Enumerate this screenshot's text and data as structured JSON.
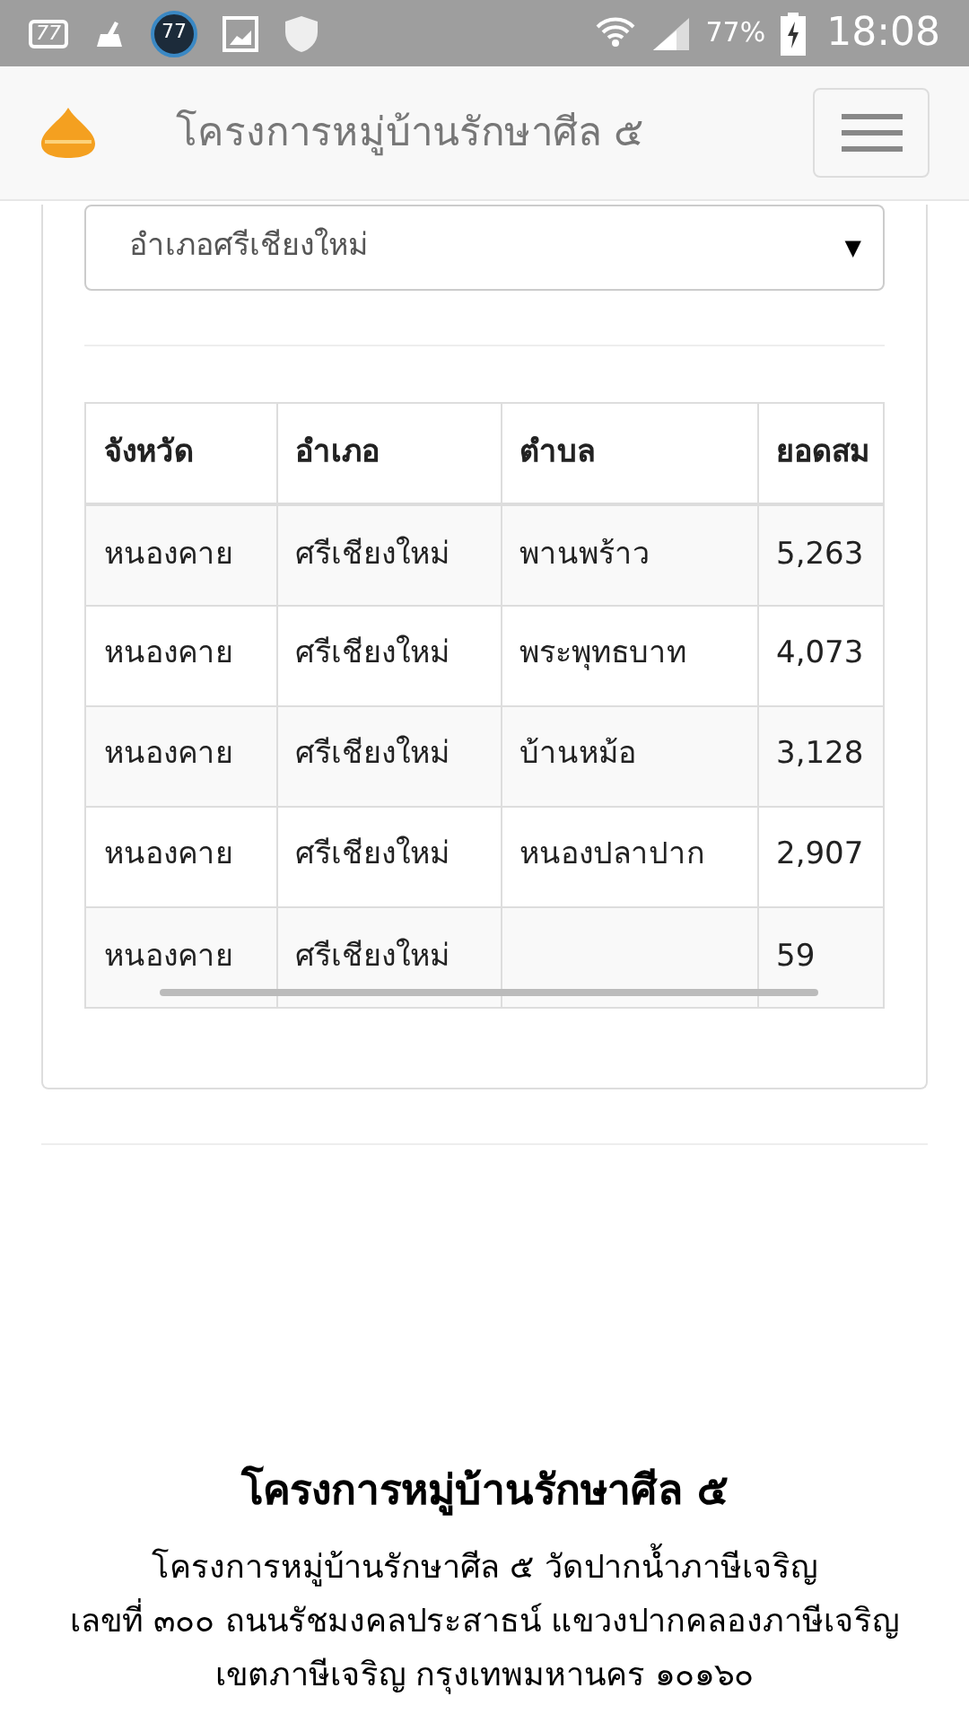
{
  "status_bar": {
    "badges": [
      "77",
      "77"
    ],
    "battery": "77%",
    "time": "18:08"
  },
  "navbar": {
    "title": "โครงการหมู่บ้านรักษาศีล ๕"
  },
  "filter": {
    "value": "อำเภอศรีเชียงใหม่",
    "caret": "▼"
  },
  "table": {
    "columns": [
      "จังหวัด",
      "อำเภอ",
      "ตำบล",
      "ยอดสม"
    ],
    "rows": [
      [
        "หนองคาย",
        "ศรีเชียงใหม่",
        "พานพร้าว",
        "5,263"
      ],
      [
        "หนองคาย",
        "ศรีเชียงใหม่",
        "พระพุทธบาท",
        "4,073"
      ],
      [
        "หนองคาย",
        "ศรีเชียงใหม่",
        "บ้านหม้อ",
        "3,128"
      ],
      [
        "หนองคาย",
        "ศรีเชียงใหม่",
        "หนองปลาปาก",
        "2,907"
      ],
      [
        "หนองคาย",
        "ศรีเชียงใหม่",
        null,
        "59"
      ]
    ]
  },
  "footer": {
    "title": "โครงการหมู่บ้านรักษาศีล ๕",
    "lines": [
      "โครงการหมู่บ้านรักษาศีล ๕ วัดปากน้ำภาษีเจริญ",
      "เลขที่ ๓๐๐ ถนนรัชมงคลประสาธน์ แขวงปากคลองภาษีเจริญ",
      "เขตภาษีเจริญ กรุงเทพมหานคร ๑๐๑๖๐"
    ]
  }
}
